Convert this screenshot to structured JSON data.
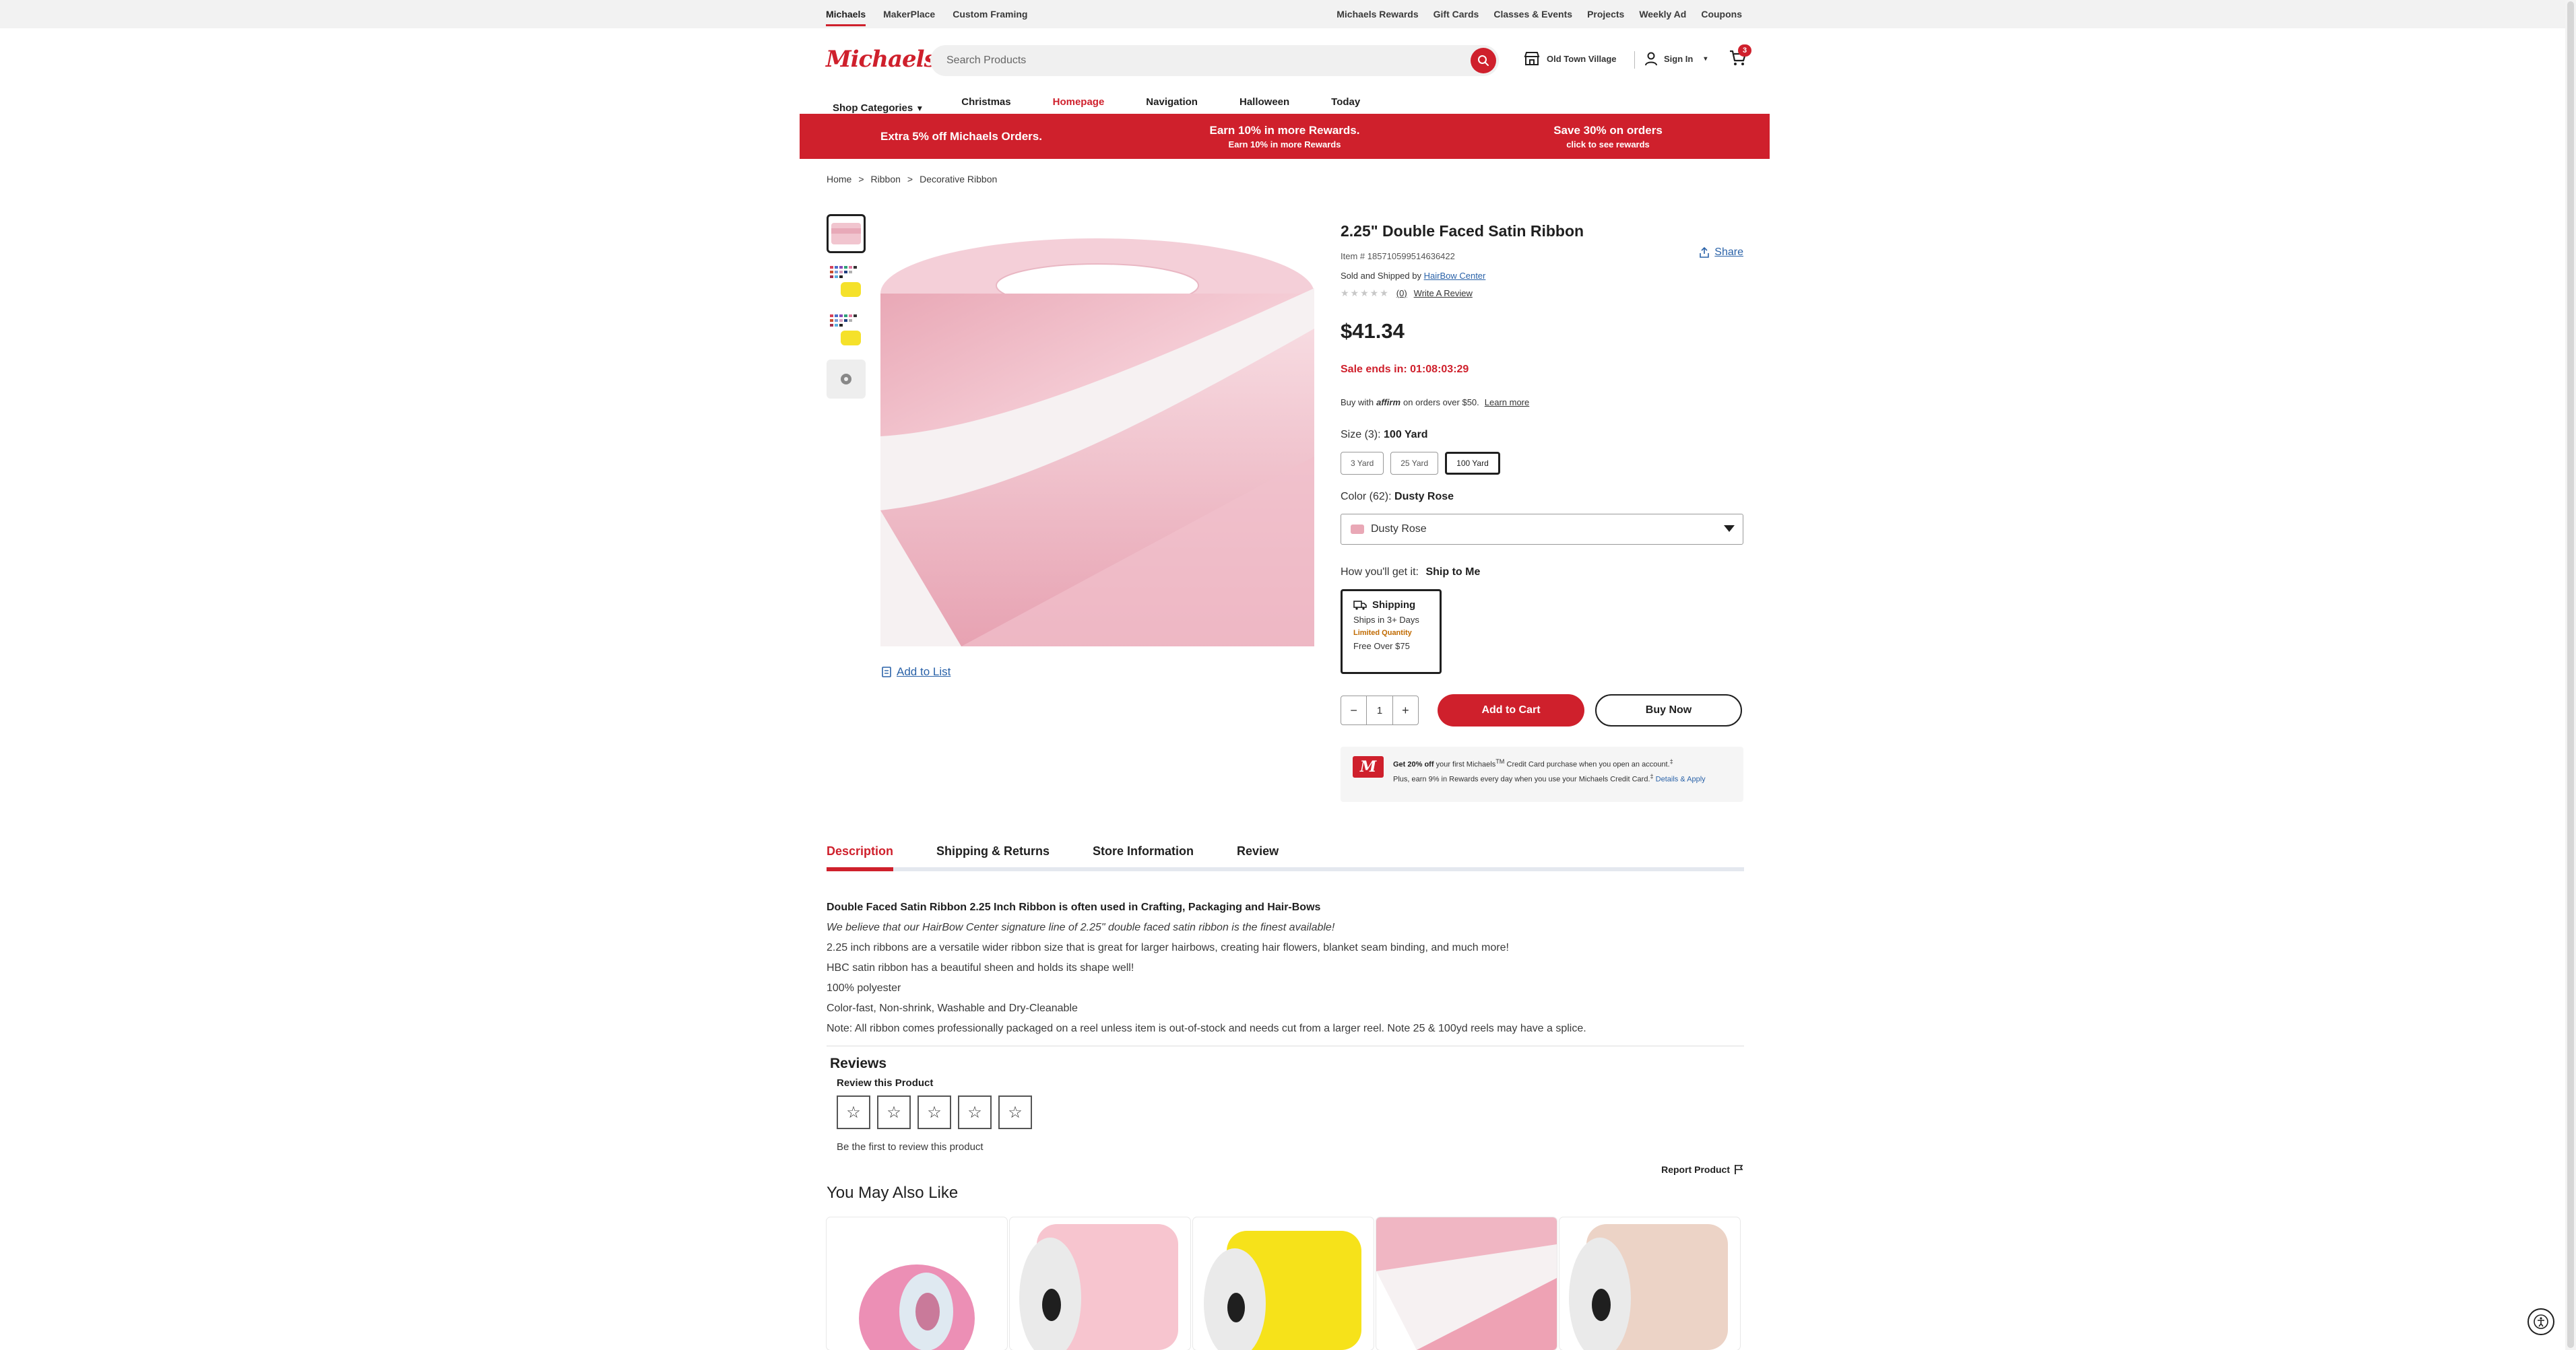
{
  "utility": {
    "left": [
      "Michaels",
      "MakerPlace",
      "Custom Framing"
    ],
    "right": [
      "Michaels Rewards",
      "Gift Cards",
      "Classes & Events",
      "Projects",
      "Weekly Ad",
      "Coupons"
    ]
  },
  "header": {
    "logo": "Michaels",
    "search_placeholder": "Search Products",
    "store": "Old Town Village",
    "signin": "Sign In",
    "cart_count": "3"
  },
  "nav": [
    "Shop Categories",
    "Christmas",
    "Homepage",
    "Navigation",
    "Halloween",
    "Today"
  ],
  "promo": [
    {
      "big": "Extra 5% off Michaels Orders.",
      "small": ""
    },
    {
      "big": "Earn 10% in more Rewards.",
      "small": "Earn 10% in more Rewards"
    },
    {
      "big": "Save 30% on orders",
      "small": "click to see rewards"
    }
  ],
  "breadcrumb": [
    "Home",
    ">",
    "Ribbon",
    ">",
    "Decorative Ribbon"
  ],
  "product": {
    "title": "2.25\" Double Faced Satin Ribbon",
    "item": "Item # 185710599514636422",
    "sold_prefix": "Sold and Shipped by",
    "seller": "HairBow Center",
    "rating_count": "(0)",
    "write_review": "Write A Review",
    "share": "Share",
    "price": "$41.34",
    "sale": "Sale ends in: 01:08:03:29",
    "affirm_prefix": "Buy with",
    "affirm_brand": "affirm",
    "affirm_suffix": "on orders over $50.",
    "affirm_link": "Learn more",
    "size_label": "Size (3):",
    "size_value": "100 Yard",
    "sizes": [
      "3 Yard",
      "25 Yard",
      "100 Yard"
    ],
    "color_label": "Color (62):",
    "color_value": "Dusty Rose",
    "color_select": "Dusty Rose",
    "how_label": "How you'll get it:",
    "how_value": "Ship to Me",
    "ship": {
      "title": "Shipping",
      "line1": "Ships in 3+ Days",
      "limited": "Limited Quantity",
      "line2": "Free Over $75"
    },
    "qty": "1",
    "add_to_cart": "Add to Cart",
    "buy_now": "Buy Now",
    "add_to_list": "Add to List",
    "credit": {
      "bold": "Get 20% off",
      "text1": "your first Michaels",
      "tm": "TM",
      "text2": "Credit Card purchase when you open an account.",
      "sup1": "‡",
      "text3": "Plus, earn 9% in Rewards every day when you use your Michaels Credit Card.",
      "sup2": "‡",
      "link": "Details & Apply"
    }
  },
  "tabs": [
    "Description",
    "Shipping & Returns",
    "Store Information",
    "Review"
  ],
  "description": [
    "Double Faced Satin Ribbon 2.25 Inch Ribbon is often used in Crafting, Packaging and Hair-Bows",
    "We believe that our HairBow Center signature line of 2.25\" double faced satin ribbon is the finest available!",
    "2.25 inch ribbons are a versatile wider ribbon size that is great for larger hairbows, creating hair flowers, blanket seam binding, and much more!",
    "HBC satin ribbon has a beautiful sheen and holds its shape well!",
    "100% polyester",
    "Color-fast, Non-shrink, Washable and Dry-Cleanable",
    "Note: All ribbon comes professionally packaged on a reel unless item is out-of-stock and needs cut from a larger reel. Note 25 & 100yd reels may have a splice."
  ],
  "reviews": {
    "title": "Reviews",
    "sub": "Review this Product",
    "first": "Be the first to review this product",
    "report": "Report Product"
  },
  "ymal": "You May Also Like",
  "colors": {
    "brand_red": "#cf202c",
    "link_blue": "#2a62a8"
  }
}
